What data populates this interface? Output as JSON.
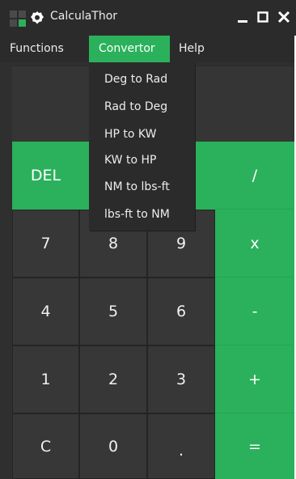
{
  "window": {
    "title": "CalculaThor"
  },
  "menubar": {
    "items": [
      {
        "label": "Functions",
        "active": false
      },
      {
        "label": "Convertor",
        "active": true
      },
      {
        "label": "Help",
        "active": false
      }
    ]
  },
  "convertor_menu": {
    "items": [
      "Deg to Rad",
      "Rad to Deg",
      "HP to KW",
      "KW to HP",
      "NM to lbs-ft",
      "lbs-ft to NM"
    ]
  },
  "display": {
    "value": ""
  },
  "keys": {
    "del": "DEL",
    "divide": "/",
    "seven": "7",
    "eight": "8",
    "nine": "9",
    "multiply": "x",
    "four": "4",
    "five": "5",
    "six": "6",
    "minus": "-",
    "one": "1",
    "two": "2",
    "three": "3",
    "plus": "+",
    "clear": "C",
    "zero": "0",
    "dot": ".",
    "equals": "="
  },
  "colors": {
    "accent": "#2bb15b",
    "background": "#2f2f2f",
    "key": "#373737",
    "bar": "#2b2b2b"
  }
}
